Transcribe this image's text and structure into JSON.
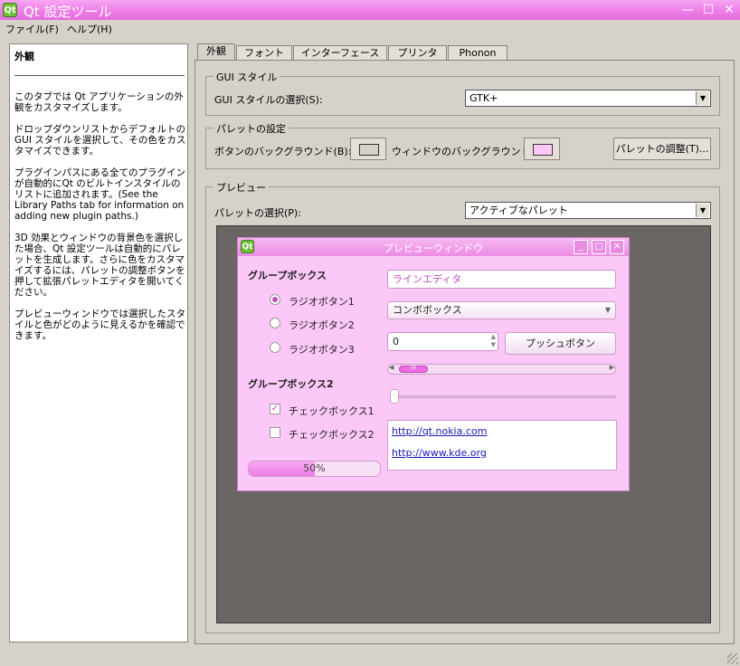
{
  "window": {
    "title": "Qt 設定ツール",
    "app_icon_text": "Qt",
    "minimize_label": "—",
    "maximize_label": "☐",
    "close_label": "✕"
  },
  "menu": {
    "file": "ファイル(F)",
    "help": "ヘルプ(H)"
  },
  "help": {
    "title": "外観",
    "paragraphs": [
      "このタブでは Qt アプリケーションの外観をカスタマイズします。",
      "ドロップダウンリストからデフォルトのGUI スタイルを選択して、その色をカスタマイズできます。",
      "プラグインパスにある全てのプラグインが自動的にQt のビルトインスタイルのリストに追加されます。(See the Library Paths tab for information on adding new plugin paths.)",
      "3D 効果とウィンドウの背景色を選択した場合、Qt 設定ツールは自動的にパレットを生成します。さらに色をカスタマイズするには、パレットの調整ボタンを押して拡張パレットエディタを開いてください。",
      "プレビューウィンドウでは選択したスタイルと色がどのように見えるかを確認できます。"
    ]
  },
  "tabs": [
    "外観",
    "フォント",
    "インターフェース",
    "プリンタ",
    "Phonon"
  ],
  "gui_style": {
    "group_title": "GUI スタイル",
    "label": "GUI スタイルの選択(S):",
    "value": "GTK+"
  },
  "palette": {
    "group_title": "パレットの設定",
    "button_bg_label": "ボタンのバックグラウンド(B):",
    "window_bg_label": "ウィンドウのバックグラウンド(",
    "adjust_button": "パレットの調整(T)...",
    "button_bg_color": "#d6d2ca",
    "window_bg_color": "#fbc8f8"
  },
  "preview": {
    "group_title": "プレビュー",
    "palette_label": "パレットの選択(P):",
    "palette_value": "アクティブなパレット",
    "window": {
      "title": "プレビューウィンドウ",
      "icon_text": "Qt",
      "minimize_label": "_",
      "maximize_label": "□",
      "close_label": "✕",
      "groupbox1": "グループボックス",
      "radios": [
        "ラジオボタン1",
        "ラジオボタン2",
        "ラジオボタン3"
      ],
      "groupbox2": "グループボックス2",
      "checks": [
        "チェックボックス1",
        "チェックボックス2"
      ],
      "check_mark": "✓",
      "line_edit": "ラインエディタ",
      "combo": "コンボボックス",
      "spin_value": "0",
      "push_button": "プッシュボタン",
      "scroll_thumb_label": "III",
      "links": [
        "http://qt.nokia.com",
        "http://www.kde.org"
      ],
      "progress": 0.5,
      "progress_text": "50%"
    }
  }
}
